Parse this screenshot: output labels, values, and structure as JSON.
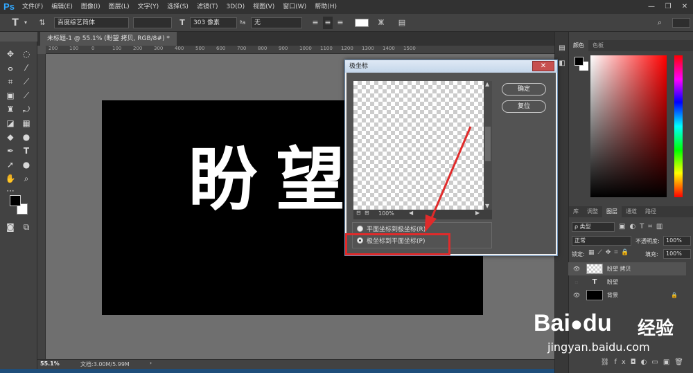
{
  "app": {
    "logo": "Ps"
  },
  "menu": [
    "文件(F)",
    "编辑(E)",
    "图像(I)",
    "图层(L)",
    "文字(Y)",
    "选择(S)",
    "滤镜(T)",
    "3D(D)",
    "视图(V)",
    "窗口(W)",
    "帮助(H)"
  ],
  "window_controls": {
    "minimize": "—",
    "restore": "❐",
    "close": "✕"
  },
  "options_bar": {
    "tool_icon": "T",
    "font_family": "百度综艺简体",
    "font_style": "",
    "font_size": "303 像素",
    "aa_label": "ªa",
    "antialias": "无"
  },
  "document": {
    "tab_title": "未标题-1 @ 55.1% (盼望 拷贝, RGB/8#) *",
    "canvas_text": "盼望",
    "zoom": "55.1%",
    "doc_info": "文档:3.00M/5.99M"
  },
  "ruler_top": [
    "200",
    "100",
    "0",
    "100",
    "200",
    "300",
    "400",
    "500",
    "600",
    "700",
    "800",
    "900",
    "1000",
    "1100",
    "1200",
    "1300",
    "1400",
    "1500"
  ],
  "dialog": {
    "title": "极坐标",
    "ok": "确定",
    "reset": "复位",
    "zoom": "100%",
    "option1": "平面坐标到极坐标(R)",
    "option2": "极坐标到平面坐标(P)",
    "selected": "option2"
  },
  "panels": {
    "color_tabs": [
      "颜色",
      "色板"
    ],
    "layer_tabs": [
      "库",
      "调整",
      "图层",
      "通道",
      "路径"
    ],
    "filter_kind": "ρ 类型",
    "blend_mode": "正常",
    "opacity_label": "不透明度:",
    "opacity": "100%",
    "lock_label": "锁定:",
    "fill_label": "填充:",
    "fill": "100%",
    "layers": [
      {
        "name": "盼望 拷贝",
        "visible": true,
        "kind": "raster"
      },
      {
        "name": "盼望",
        "visible": false,
        "kind": "text"
      },
      {
        "name": "背景",
        "visible": true,
        "kind": "background"
      }
    ]
  },
  "watermark": {
    "brand": "Bai",
    "brand2": "du",
    "cn": "经验",
    "url": "jingyan.baidu.com"
  },
  "colors": {
    "accent": "#31a8ff",
    "highlight": "#e02b2b"
  }
}
